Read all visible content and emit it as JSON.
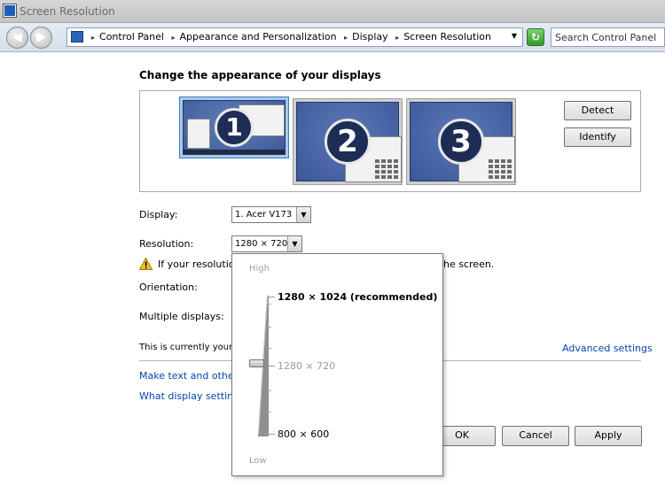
{
  "window": {
    "title": "Screen Resolution"
  },
  "nav": {
    "back_glyph": "◀",
    "forward_glyph": "▶",
    "breadcrumbs": [
      "Control Panel",
      "Appearance and Personalization",
      "Display",
      "Screen Resolution"
    ],
    "separator": "▸",
    "dropdown_glyph": "▼",
    "refresh_glyph": "↻",
    "search_placeholder": "Search Control Panel"
  },
  "main": {
    "heading": "Change the appearance of your displays",
    "monitors": [
      {
        "number": "1",
        "selected": true
      },
      {
        "number": "2",
        "selected": false
      },
      {
        "number": "3",
        "selected": false
      }
    ],
    "detect_label": "Detect",
    "identify_label": "Identify",
    "display_label": "Display:",
    "display_value": "1. Acer V173",
    "resolution_label": "Resolution:",
    "resolution_value": "1280 × 720",
    "warning_text_start": "If your resolution",
    "warning_text_end": "he screen.",
    "orientation_label": "Orientation:",
    "multiple_displays_label": "Multiple displays:",
    "current_text": "This is currently your m",
    "advanced_settings_link": "Advanced settings",
    "make_text_link": "Make text and other it",
    "what_display_link": "What display settings",
    "ok_label": "OK",
    "cancel_label": "Cancel",
    "apply_label": "Apply"
  },
  "resolution_popup": {
    "high_label": "High",
    "low_label": "Low",
    "options": {
      "recommended": "1280 × 1024 (recommended)",
      "current": "1280 × 720",
      "minimum": "800 × 600"
    }
  },
  "colors": {
    "link": "#0645ad",
    "monitor_bg": "#4a66a8",
    "selected_border": "#3d7bbf"
  }
}
